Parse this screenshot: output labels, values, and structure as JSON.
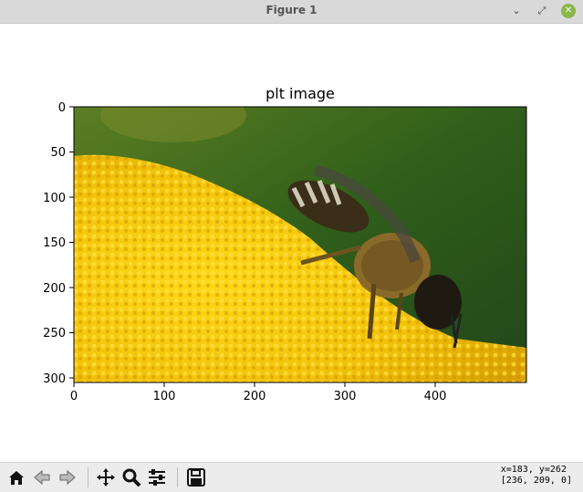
{
  "window": {
    "title": "Figure 1",
    "minimize_symbol": "⌄",
    "restore_symbol": "⤢",
    "close_symbol": "✕"
  },
  "figure": {
    "title": "plt image",
    "x_ticks": [
      "0",
      "100",
      "200",
      "300",
      "400"
    ],
    "y_ticks": [
      "0",
      "50",
      "100",
      "150",
      "200",
      "250",
      "300"
    ],
    "image_description_icon": "bee-on-yellow-flower-photo"
  },
  "toolbar": {
    "buttons": [
      "home-icon",
      "back-icon",
      "forward-icon",
      "pan-icon",
      "zoom-icon",
      "configure-subplots-icon",
      "save-icon"
    ],
    "coord_line1": "x=183, y=262",
    "coord_line2": "[236, 209, 0]"
  },
  "colors": {
    "flower": "#f4c60a",
    "background_green": "#2f5e1a",
    "bee": "#3a2e18"
  }
}
